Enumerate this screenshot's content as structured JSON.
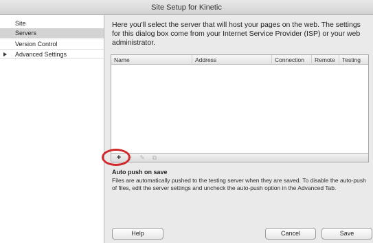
{
  "window": {
    "title": "Site Setup for Kinetic"
  },
  "sidebar": {
    "items": [
      {
        "label": "Site"
      },
      {
        "label": "Servers"
      },
      {
        "label": "Version Control"
      },
      {
        "label": "Advanced Settings"
      }
    ]
  },
  "main": {
    "intro": "Here you'll select the server that will host your pages on the web. The settings for this dialog box come from your Internet Service Provider (ISP) or your web administrator.",
    "table": {
      "columns": [
        "Name",
        "Address",
        "Connection",
        "Remote",
        "Testing"
      ],
      "rows": []
    },
    "toolbar": {
      "add": "+",
      "remove": "−",
      "edit": "✎",
      "duplicate": "⧉"
    },
    "autopush": {
      "title": "Auto push on save",
      "text": "Files are automatically pushed to the testing server when they are saved. To disable the auto-push of files, edit the server settings and uncheck the auto-push option in the Advanced Tab."
    }
  },
  "buttons": {
    "help": "Help",
    "cancel": "Cancel",
    "save": "Save"
  },
  "colors": {
    "highlight": "#d0292b",
    "selected_row": "#d4d4d4"
  }
}
